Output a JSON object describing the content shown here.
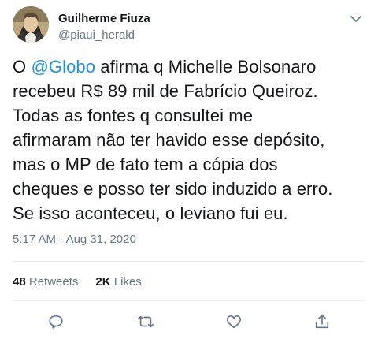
{
  "author": {
    "display_name": "Guilherme Fiuza",
    "handle": "@piaui_herald"
  },
  "tweet": {
    "lines": [
      {
        "before": "O ",
        "mention": "@Globo",
        "after": " afirma q Michelle Bolsonaro"
      },
      "recebeu R$ 89 mil de Fabrício Queiroz.",
      "Todas as fontes q consultei me",
      "afirmaram não ter havido esse depósito,",
      "mas o MP de fato tem a cópia dos",
      "cheques e posso ter sido induzido a erro.",
      "Se isso aconteceu, o leviano fui eu."
    ],
    "time": "5:17 AM",
    "separator": "·",
    "date": "Aug 31, 2020"
  },
  "stats": {
    "retweets_count": "48",
    "retweets_label": "Retweets",
    "likes_count": "2K",
    "likes_label": "Likes"
  },
  "actions": {
    "icons": [
      "reply-icon",
      "retweet-icon",
      "like-icon",
      "share-icon"
    ]
  },
  "colors": {
    "text": "#14171a",
    "secondary": "#657786",
    "link": "#1b95e0",
    "divider": "#e6ecf0"
  }
}
